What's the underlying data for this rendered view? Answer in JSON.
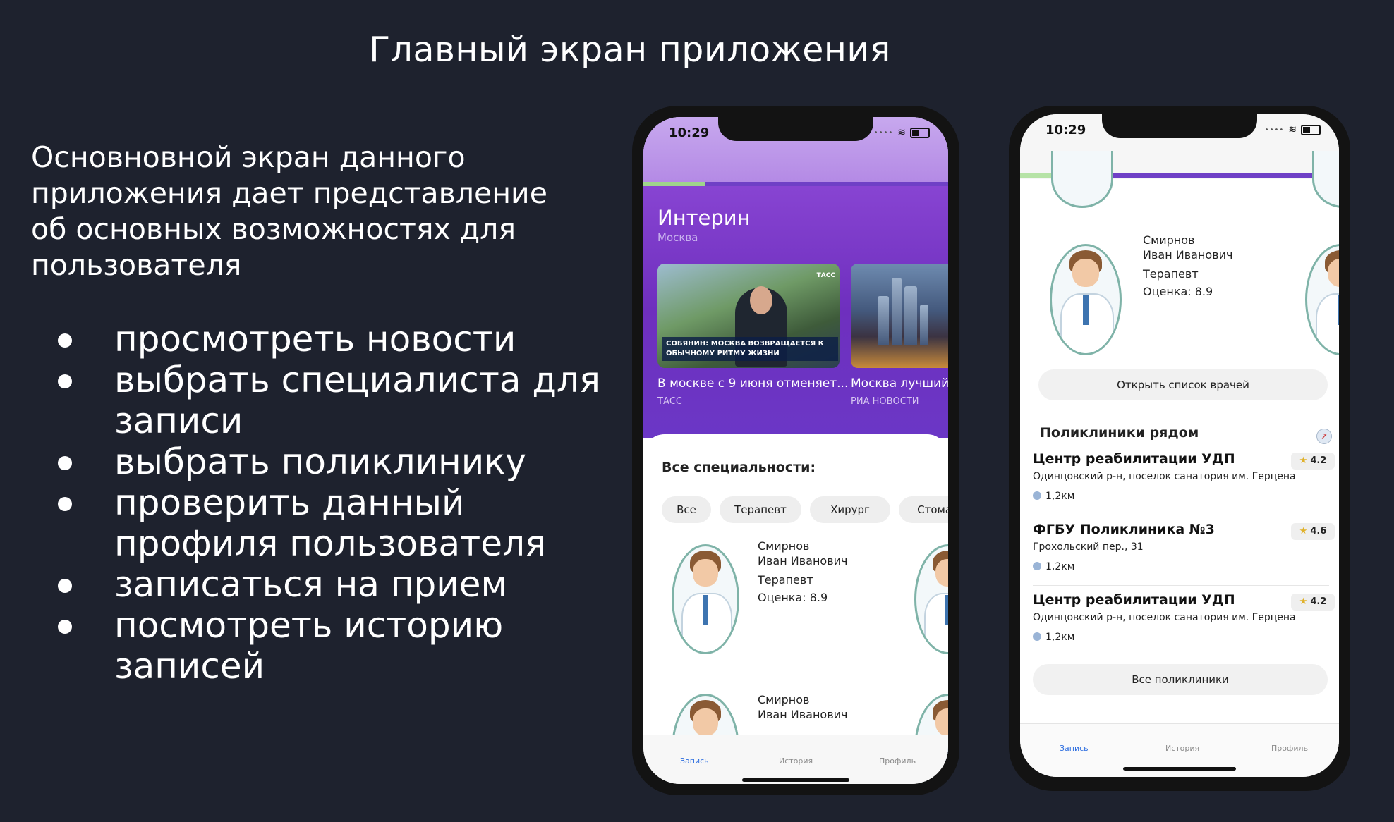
{
  "slide": {
    "title": "Главный экран приложения",
    "intro": "Основновной экран данного приложения дает представление об основных возможностях для пользователя",
    "bullets": [
      "просмотреть новости",
      "выбрать специалиста для записи",
      "выбрать поликлинику",
      "проверить данный профиля пользователя",
      "записаться на прием",
      "посмотреть историю записей"
    ]
  },
  "phone1": {
    "time": "10:29",
    "app_title": "Интерин",
    "city": "Москва",
    "news": [
      {
        "title": "В москве с 9 июня отменяет...",
        "source": "ТАСС",
        "caption": "СОБЯНИН: МОСКВА ВОЗВРАЩАЕТСЯ К ОБЫЧНОМУ РИТМУ ЖИЗНИ",
        "logo": "ТАСС"
      },
      {
        "title": "Москва лучший",
        "source": "РИА НОВОСТИ"
      }
    ],
    "specialties_title": "Все специальности:",
    "chips": [
      "Все",
      "Терапевт",
      "Хирург",
      "Стомат"
    ],
    "doctors": [
      {
        "name1": "Смирнов",
        "name2": "Иван Иванович",
        "specialty": "Терапевт",
        "rating": "Оценка: 8.9"
      },
      {
        "name1": "Смирнов",
        "name2": "Иван Иванович"
      }
    ],
    "tabs": [
      "Запись",
      "История",
      "Профиль"
    ]
  },
  "phone2": {
    "time": "10:29",
    "doctor": {
      "name1": "Смирнов",
      "name2": "Иван Иванович",
      "specialty": "Терапевт",
      "rating": "Оценка: 8.9"
    },
    "open_doctors_button": "Открыть список врачей",
    "nearby_title": "Поликлиники рядом",
    "clinics": [
      {
        "name": "Центр реабилитации УДП",
        "address": "Одинцовский р-н, поселок санатория им. Герцена",
        "distance": "1,2км",
        "rating": "4.2"
      },
      {
        "name": "ФГБУ Поликлиника №3",
        "address": "Грохольский пер., 31",
        "distance": "1,2км",
        "rating": "4.6"
      },
      {
        "name": "Центр реабилитации УДП",
        "address": "Одинцовский р-н, поселок санатория им. Герцена",
        "distance": "1,2км",
        "rating": "4.2"
      }
    ],
    "all_clinics_button": "Все поликлиники",
    "tabs": [
      "Запись",
      "История",
      "Профиль"
    ]
  }
}
